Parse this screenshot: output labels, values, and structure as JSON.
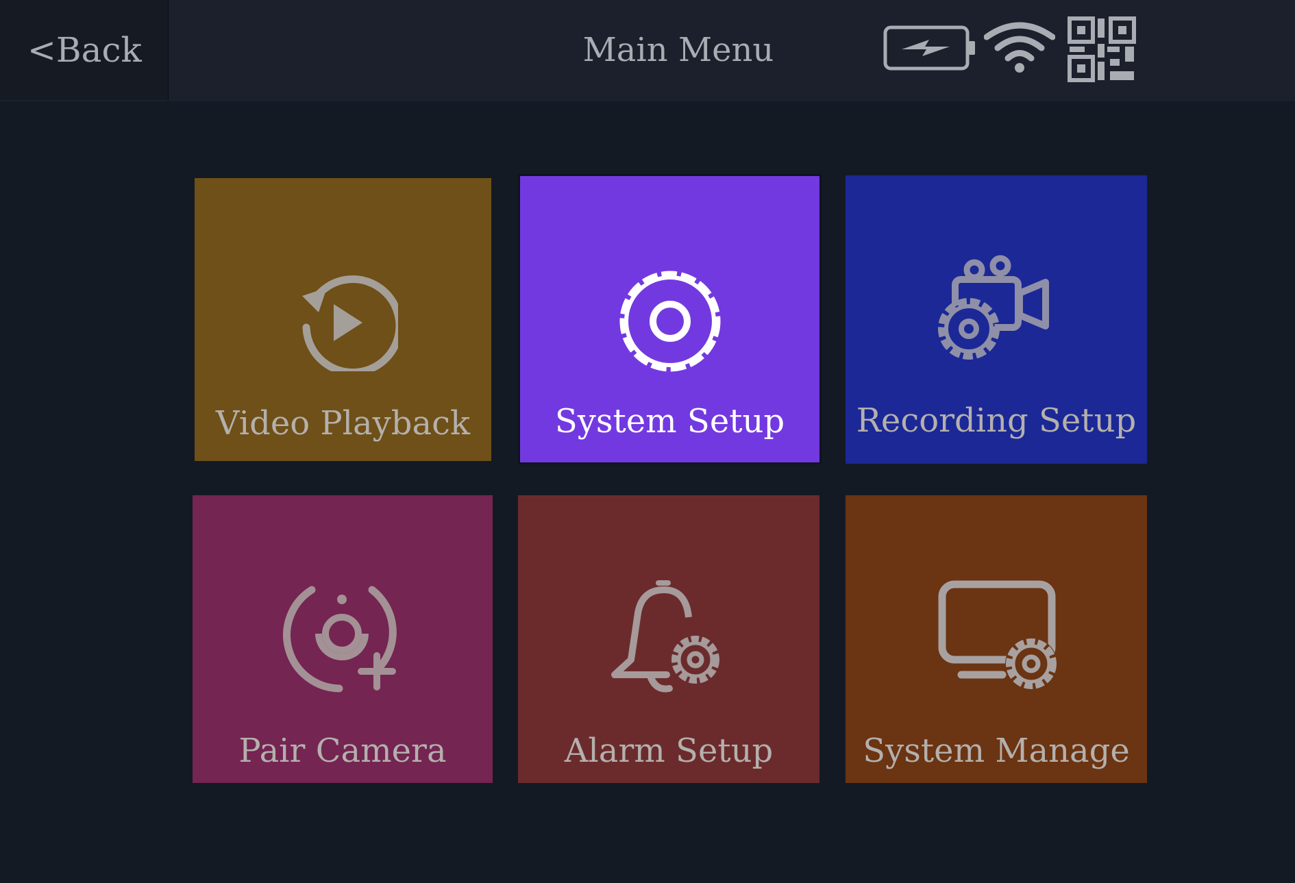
{
  "header": {
    "back_label": "<Back",
    "title": "Main Menu"
  },
  "status_icons": [
    "battery-charging-icon",
    "wifi-icon",
    "qr-code-icon"
  ],
  "menu": {
    "selected_index": 1,
    "tiles": [
      {
        "label": "Video Playback",
        "icon": "playback-icon",
        "color": "#6e5018"
      },
      {
        "label": "System Setup",
        "icon": "gear-icon",
        "color": "#7339e0"
      },
      {
        "label": "Recording Setup",
        "icon": "camera-settings-icon",
        "color": "#1b2896"
      },
      {
        "label": "Pair Camera",
        "icon": "pair-camera-icon",
        "color": "#742551"
      },
      {
        "label": "Alarm Setup",
        "icon": "alarm-settings-icon",
        "color": "#6b2b2c"
      },
      {
        "label": "System Manage",
        "icon": "monitor-settings-icon",
        "color": "#6b3412"
      }
    ]
  }
}
